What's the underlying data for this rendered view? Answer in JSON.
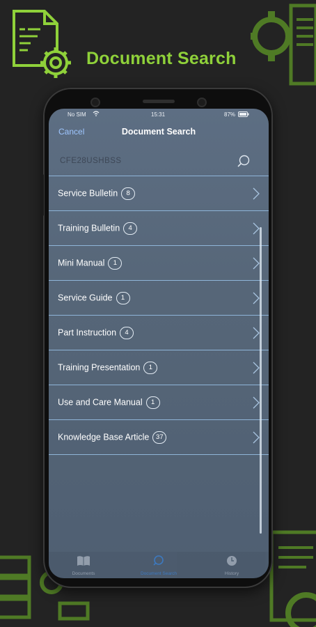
{
  "promo": {
    "title": "Document Search"
  },
  "status_bar": {
    "carrier": "No SIM",
    "time": "15:31",
    "battery": "87%"
  },
  "nav": {
    "cancel_label": "Cancel",
    "title": "Document Search"
  },
  "search": {
    "value": "CFE28USHBSS"
  },
  "results": [
    {
      "label": "Service Bulletin",
      "count": "8"
    },
    {
      "label": "Training Bulletin",
      "count": "4"
    },
    {
      "label": "Mini Manual",
      "count": "1"
    },
    {
      "label": "Service Guide",
      "count": "1"
    },
    {
      "label": "Part Instruction",
      "count": "4"
    },
    {
      "label": "Training Presentation",
      "count": "1"
    },
    {
      "label": "Use and Care Manual",
      "count": "1"
    },
    {
      "label": "Knowledge Base Article",
      "count": "37"
    }
  ],
  "tabs": [
    {
      "label": "Documents",
      "icon": "book-icon"
    },
    {
      "label": "Document Search",
      "icon": "search-icon",
      "active": true
    },
    {
      "label": "History",
      "icon": "clock-icon"
    }
  ],
  "colors": {
    "brand_green": "#8fd13a",
    "background": "#232323",
    "screen": "#566678",
    "divider": "#8fb5d8",
    "link_blue": "#9ec6ff",
    "active_tab": "#2e8fff"
  }
}
